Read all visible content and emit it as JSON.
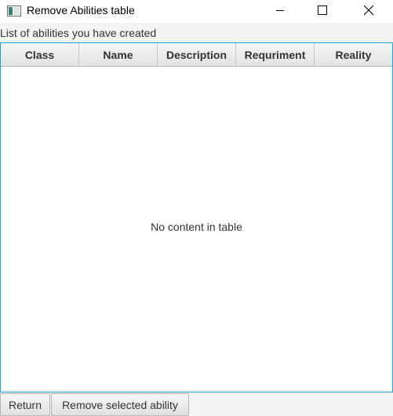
{
  "window": {
    "title": "Remove Abilities table",
    "icons": [
      "app-icon",
      "minimize-icon",
      "maximize-icon",
      "close-icon"
    ]
  },
  "caption": "List of abilities you have created",
  "table": {
    "columns": [
      "Class",
      "Name",
      "Description",
      "Requriment",
      "Reality"
    ],
    "rows": [],
    "placeholder": "No content in table",
    "focus_border_color": "#1ea1d6"
  },
  "buttons": {
    "return_label": "Return",
    "remove_label": "Remove selected ability"
  }
}
